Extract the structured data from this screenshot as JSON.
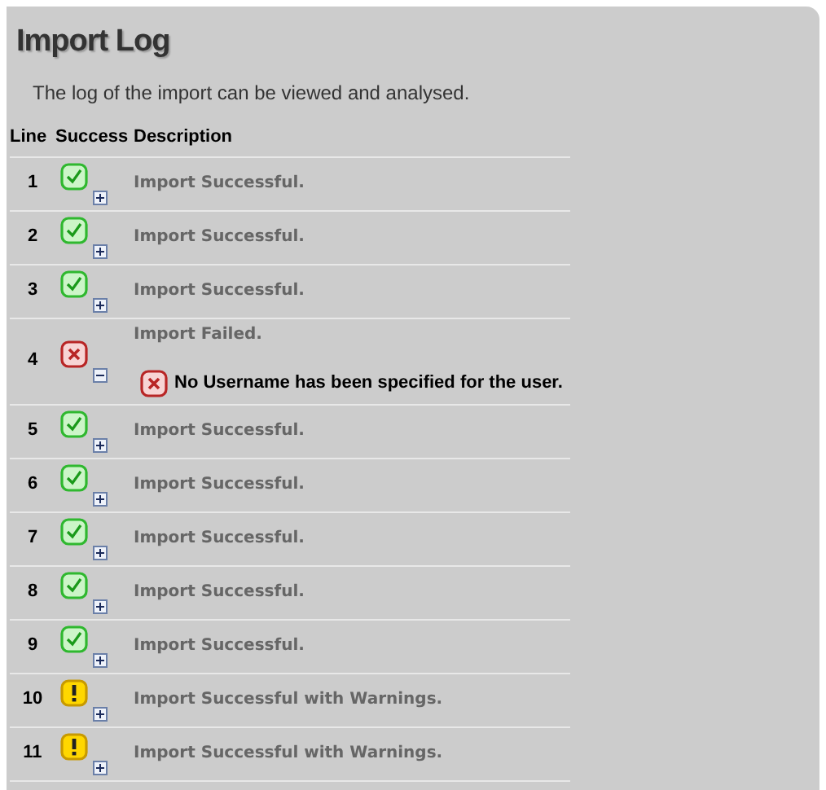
{
  "title": "Import Log",
  "intro": "The log of the import can be viewed and analysed.",
  "table": {
    "columns": [
      "Line",
      "Success",
      "Description"
    ],
    "rows": [
      {
        "line": "1",
        "kind": "success",
        "expanded": false,
        "description": "Import Successful."
      },
      {
        "line": "2",
        "kind": "success",
        "expanded": false,
        "description": "Import Successful."
      },
      {
        "line": "3",
        "kind": "success",
        "expanded": false,
        "description": "Import Successful."
      },
      {
        "line": "4",
        "kind": "failed",
        "expanded": true,
        "description": "Import Failed.",
        "details": [
          {
            "kind": "failed",
            "text": "No Username has been specified for the user."
          }
        ]
      },
      {
        "line": "5",
        "kind": "success",
        "expanded": false,
        "description": "Import Successful."
      },
      {
        "line": "6",
        "kind": "success",
        "expanded": false,
        "description": "Import Successful."
      },
      {
        "line": "7",
        "kind": "success",
        "expanded": false,
        "description": "Import Successful."
      },
      {
        "line": "8",
        "kind": "success",
        "expanded": false,
        "description": "Import Successful."
      },
      {
        "line": "9",
        "kind": "success",
        "expanded": false,
        "description": "Import Successful."
      },
      {
        "line": "10",
        "kind": "warning",
        "expanded": false,
        "description": "Import Successful with Warnings."
      },
      {
        "line": "11",
        "kind": "warning",
        "expanded": false,
        "description": "Import Successful with Warnings."
      }
    ]
  }
}
